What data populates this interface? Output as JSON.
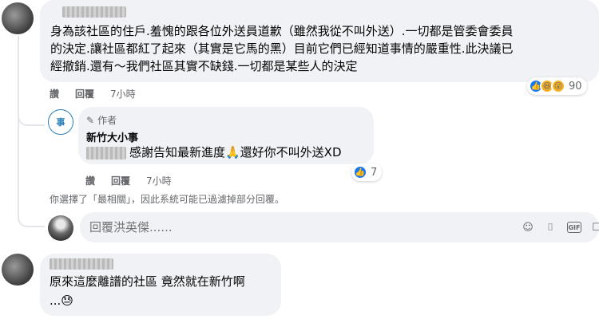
{
  "comment1": {
    "lines": [
      "身為該社區的住戶.羞愧的跟各位外送員道歉（雖然我從不叫外送）.一切都是管委會委員",
      "的決定.讓社區都紅了起來（其實是它馬的黑）目前它們已經知道事情的嚴重性.此決議已",
      "經撤銷.還有～我們社區其實不缺錢.一切都是某些人的決定"
    ],
    "like_label": "讚",
    "reply_label": "回覆",
    "time": "7小時",
    "reaction_count": "90"
  },
  "reply1": {
    "badge": "作者",
    "author": "新竹大小事",
    "text": "感謝告知最新進度🙏還好你不叫外送XD",
    "like_label": "讚",
    "reply_label": "回覆",
    "time": "7小時",
    "reaction_count": "7"
  },
  "notice": "你選擇了「最相關」，因此系統可能已過濾掉部分回覆。",
  "reply_box": {
    "placeholder": "回覆洪英傑......"
  },
  "comment2": {
    "lines": [
      "原來這麼離譜的社區 竟然就在新竹啊",
      "...😓"
    ]
  },
  "icons": {
    "like": "thumbs-up-icon",
    "haha": "haha-reaction-icon",
    "wow": "wow-reaction-icon",
    "pencil": "pencil-icon",
    "emoji": "emoji-icon",
    "camera": "camera-icon",
    "gif": "gif-icon",
    "sticker": "sticker-icon"
  },
  "colors": {
    "bubble": "#f0f2f5",
    "meta": "#65676b",
    "like_blue": "#1877f2",
    "reaction_yellow": "#f7b125",
    "page_avatar": "#2a7fb8"
  }
}
